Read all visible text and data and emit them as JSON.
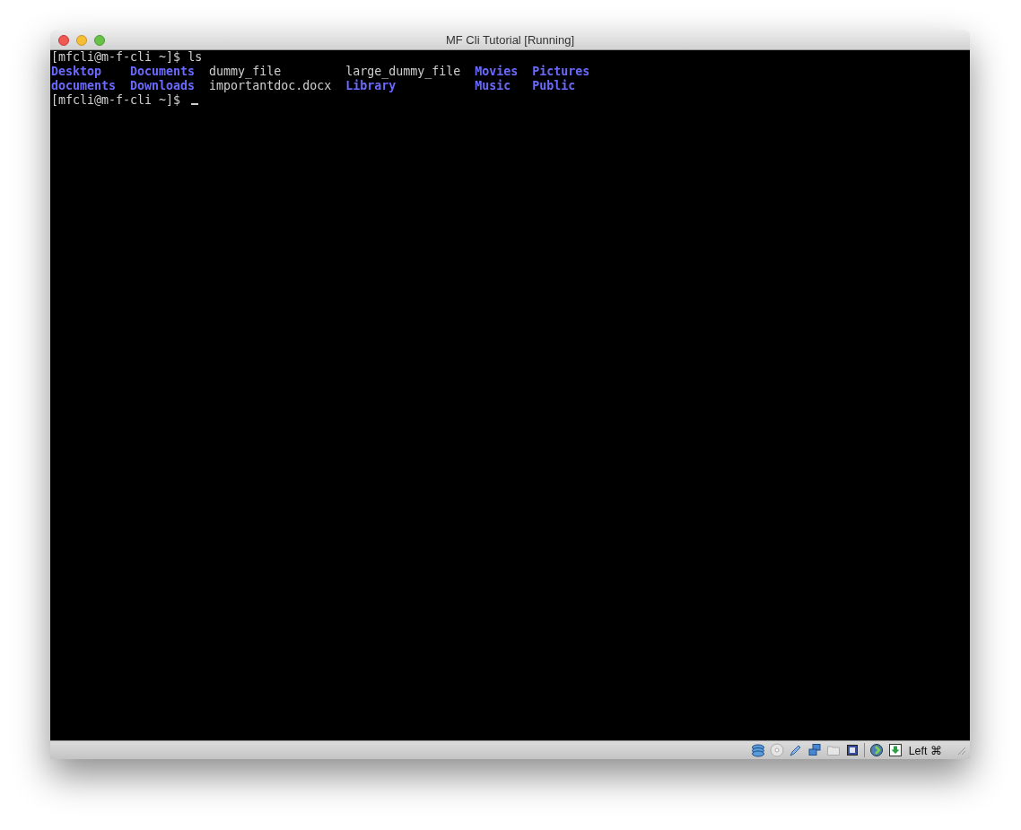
{
  "window": {
    "title": "MF Cli Tutorial [Running]"
  },
  "terminal": {
    "lines": [
      {
        "prompt": "[mfcli@m-f-cli ~]$",
        "command": "ls"
      }
    ],
    "ls_output": [
      {
        "entries": [
          {
            "name": "Desktop",
            "kind": "dir"
          },
          {
            "name": "documents",
            "kind": "dir"
          }
        ]
      },
      {
        "entries": [
          {
            "name": "Documents",
            "kind": "dir"
          },
          {
            "name": "Downloads",
            "kind": "dir"
          }
        ]
      },
      {
        "entries": [
          {
            "name": "dummy_file",
            "kind": "file"
          },
          {
            "name": "importantdoc.docx",
            "kind": "file"
          }
        ]
      },
      {
        "entries": [
          {
            "name": "large_dummy_file",
            "kind": "file"
          },
          {
            "name": "Library",
            "kind": "dir"
          }
        ]
      },
      {
        "entries": [
          {
            "name": "Movies",
            "kind": "dir"
          },
          {
            "name": "Music",
            "kind": "dir"
          }
        ]
      },
      {
        "entries": [
          {
            "name": "Pictures",
            "kind": "dir"
          },
          {
            "name": "Public",
            "kind": "dir"
          }
        ]
      }
    ],
    "current_prompt": "[mfcli@m-f-cli ~]$"
  },
  "status_bar": {
    "host_key": "Left ⌘"
  }
}
